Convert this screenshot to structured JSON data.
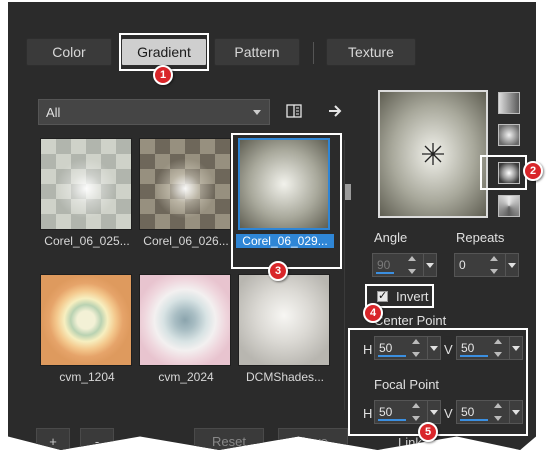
{
  "tabs": [
    {
      "label": "Color",
      "active": false
    },
    {
      "label": "Gradient",
      "active": true
    },
    {
      "label": "Pattern",
      "active": false
    },
    {
      "label": "Texture",
      "active": false
    }
  ],
  "library": {
    "category": "All",
    "swatches": [
      {
        "label": "Corel_06_025...",
        "selected": false
      },
      {
        "label": "Corel_06_026...",
        "selected": false
      },
      {
        "label": "Corel_06_029...",
        "selected": true
      },
      {
        "label": "cvm_1204",
        "selected": false
      },
      {
        "label": "cvm_2024",
        "selected": false
      },
      {
        "label": "DCMShades..."
      }
    ]
  },
  "angle": {
    "label": "Angle",
    "value": "90"
  },
  "repeats": {
    "label": "Repeats",
    "value": "0"
  },
  "invert": {
    "label": "Invert",
    "checked": true
  },
  "center_point": {
    "label": "Center Point",
    "h_label": "H",
    "h_value": "50",
    "v_label": "V",
    "v_value": "50"
  },
  "focal_point": {
    "label": "Focal Point",
    "h_label": "H",
    "h_value": "50",
    "v_label": "V",
    "v_value": "50"
  },
  "bottom": {
    "add": "+",
    "remove": "-",
    "reset": "Reset",
    "save": "Save",
    "link": "Link"
  },
  "callouts": [
    "1",
    "2",
    "3",
    "4",
    "5"
  ],
  "colors": {
    "accent": "#2f86d6",
    "callout": "#d9262a",
    "panel": "#2b2b2b"
  }
}
